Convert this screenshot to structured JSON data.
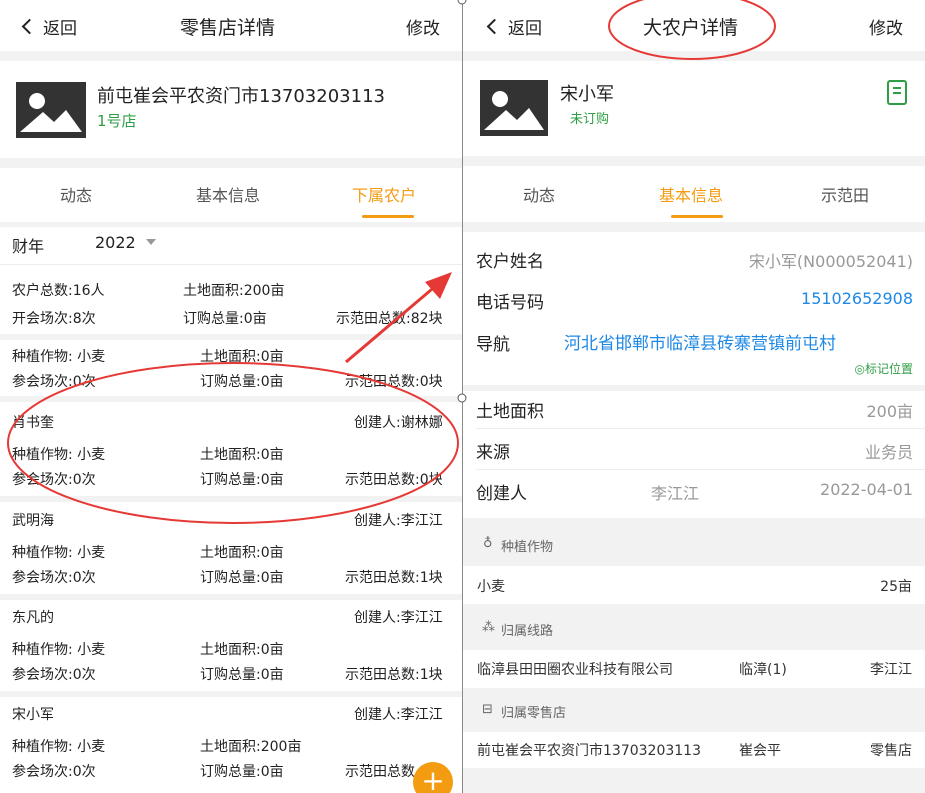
{
  "left": {
    "back_label": "返回",
    "title": "零售店详情",
    "edit_label": "修改",
    "store_name": "前屯崔会平农资门市13703203113",
    "store_tag": "1号店",
    "tabs": [
      "动态",
      "基本信息",
      "下属农户"
    ],
    "year_label": "财年",
    "year_value": "2022",
    "summary": {
      "farmers": "农户总数:16人",
      "land": "土地面积:200亩",
      "meetings": "开会场次:8次",
      "orders": "订购总量:0亩",
      "demo": "示范田总数:82块"
    },
    "farmer_list": [
      {
        "name": "",
        "creator": "",
        "crop": "种植作物: 小麦",
        "land": "土地面积:0亩",
        "attend": "参会场次:0次",
        "order": "订购总量:0亩",
        "demo": "示范田总数:0块"
      },
      {
        "name": "肖书奎",
        "creator": "创建人:谢林娜",
        "crop": "种植作物: 小麦",
        "land": "土地面积:0亩",
        "attend": "参会场次:0次",
        "order": "订购总量:0亩",
        "demo": "示范田总数:0块"
      },
      {
        "name": "武明海",
        "creator": "创建人:李江江",
        "crop": "种植作物: 小麦",
        "land": "土地面积:0亩",
        "attend": "参会场次:0次",
        "order": "订购总量:0亩",
        "demo": "示范田总数:1块"
      },
      {
        "name": "东凡的",
        "creator": "创建人:李江江",
        "crop": "种植作物: 小麦",
        "land": "土地面积:0亩",
        "attend": "参会场次:0次",
        "order": "订购总量:0亩",
        "demo": "示范田总数:1块"
      },
      {
        "name": "宋小军",
        "creator": "创建人:李江江",
        "crop": "种植作物: 小麦",
        "land": "土地面积:200亩",
        "attend": "参会场次:0次",
        "order": "订购总量:0亩",
        "demo": "示范田总数"
      }
    ],
    "fab_label": "+"
  },
  "right": {
    "back_label": "返回",
    "title": "大农户详情",
    "edit_label": "修改",
    "farmer_name": "宋小军",
    "order_status": "未订购",
    "tabs": [
      "动态",
      "基本信息",
      "示范田"
    ],
    "info": {
      "name_label": "农户姓名",
      "name_value": "宋小军(N000052041)",
      "phone_label": "电话号码",
      "phone_value": "15102652908",
      "nav_label": "导航",
      "address": "河北省邯郸市临漳县砖寨营镇前屯村",
      "mark_location": "标记位置",
      "land_label": "土地面积",
      "land_value": "200亩",
      "source_label": "来源",
      "source_value": "业务员",
      "creator_label": "创建人",
      "creator_value": "李江江",
      "created_date": "2022-04-01"
    },
    "crops_section": "种植作物",
    "crop_name": "小麦",
    "crop_area": "25亩",
    "route_section": "归属线路",
    "route_company": "临漳县田田圈农业科技有限公司",
    "route_area": "临漳(1)",
    "route_person": "李江江",
    "store_section": "归属零售店",
    "store_name": "前屯崔会平农资门市13703203113",
    "store_owner": "崔会平",
    "store_type": "零售店"
  },
  "colors": {
    "accent": "#f39c12",
    "link": "#1e88e5",
    "green": "#2e9e44",
    "annotation": "#e53935"
  }
}
